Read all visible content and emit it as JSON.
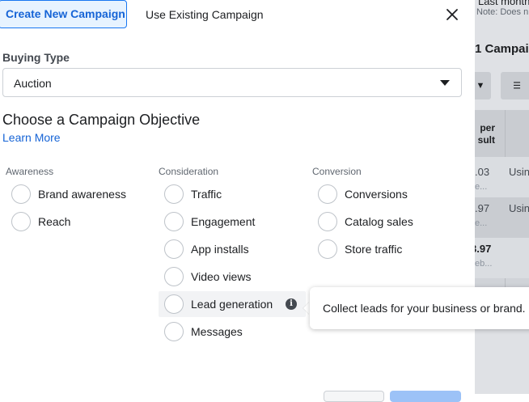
{
  "background": {
    "date_range": "Last month",
    "note": "Note: Does n",
    "campaigns_title": "1 Campai",
    "column_header": [
      "per",
      "sult"
    ],
    "rows": [
      {
        "value": ".03",
        "sub": "e...",
        "col2": "Usin"
      },
      {
        "value": ".97",
        "sub": "e...",
        "col2": "Usin"
      },
      {
        "value": "3.97",
        "sub": "eb...",
        "col2": ""
      }
    ]
  },
  "modal": {
    "tabs": [
      {
        "label": "Create New Campaign",
        "active": true
      },
      {
        "label": "Use Existing Campaign",
        "active": false
      }
    ],
    "close_icon": "close-x",
    "buying_type": {
      "label": "Buying Type",
      "selected": "Auction"
    },
    "objective": {
      "heading": "Choose a Campaign Objective",
      "learn_more": "Learn More",
      "columns": [
        {
          "title": "Awareness",
          "options": [
            "Brand awareness",
            "Reach"
          ]
        },
        {
          "title": "Consideration",
          "options": [
            "Traffic",
            "Engagement",
            "App installs",
            "Video views",
            "Lead generation",
            "Messages"
          ]
        },
        {
          "title": "Conversion",
          "options": [
            "Conversions",
            "Catalog sales",
            "Store traffic"
          ]
        }
      ],
      "hovered_option": "Lead generation",
      "tooltip": "Collect leads for your business or brand."
    }
  },
  "colors": {
    "accent": "#1877f2",
    "link": "#1664d6",
    "tab_active_bg": "#e7f3ff"
  }
}
